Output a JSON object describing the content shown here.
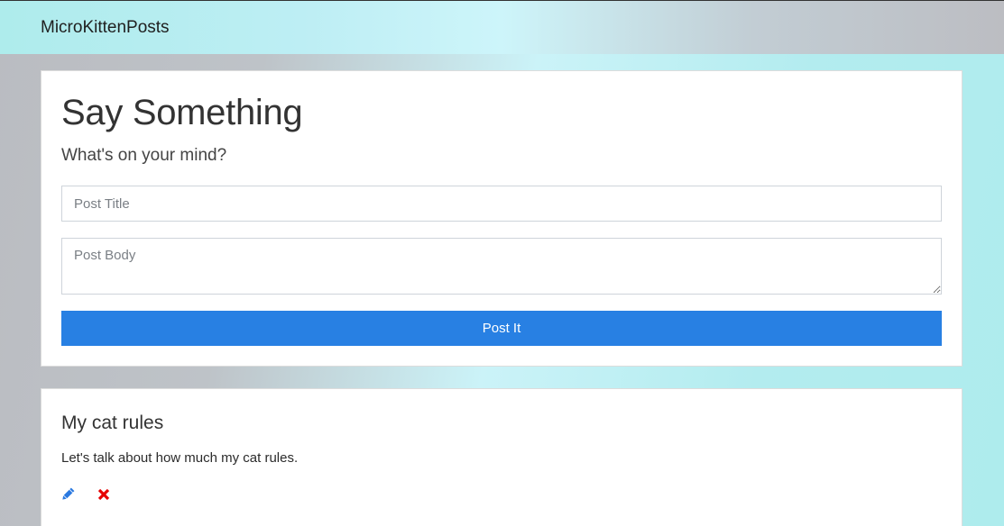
{
  "navbar": {
    "brand": "MicroKittenPosts"
  },
  "form": {
    "heading": "Say Something",
    "subheading": "What's on your mind?",
    "title_placeholder": "Post Title",
    "body_placeholder": "Post Body",
    "submit_label": "Post It"
  },
  "posts": [
    {
      "title": "My cat rules",
      "body": "Let's talk about how much my cat rules.",
      "edit_icon": "pencil-icon",
      "delete_icon": "x-icon"
    }
  ],
  "colors": {
    "primary_button": "#2880e3",
    "edit_icon": "#2a79e0",
    "delete_icon": "#e60000"
  }
}
